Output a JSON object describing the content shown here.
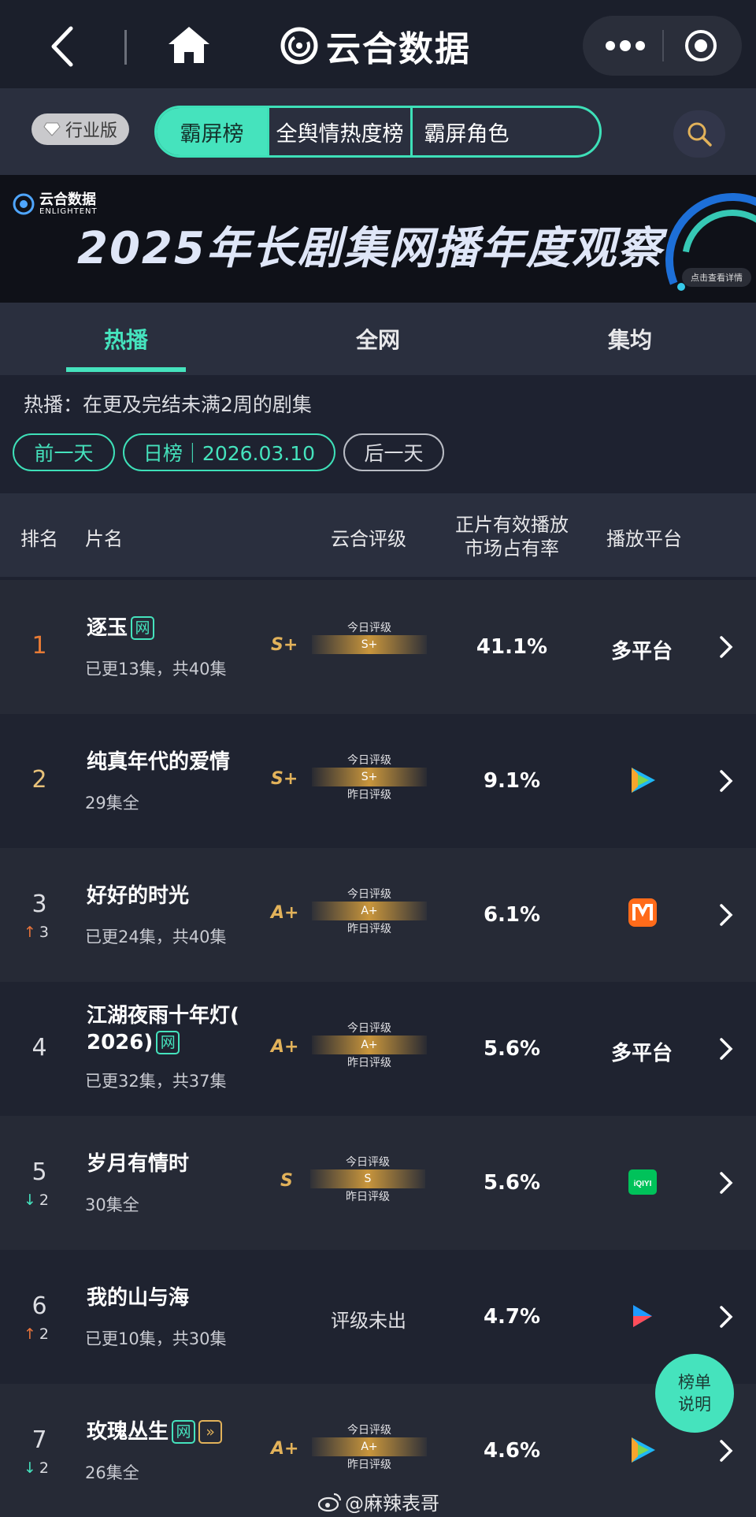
{
  "app": {
    "title": "云合数据"
  },
  "filter": {
    "edition": "行业版",
    "segments": [
      "霸屏榜",
      "全舆情热度榜",
      "霸屏角色"
    ]
  },
  "banner": {
    "brand": "云合数据",
    "brand_en": "ENLIGHTENT",
    "title": "2025年长剧集网播年度观察",
    "cta": "点击查看详情"
  },
  "tabs": [
    "热播",
    "全网",
    "集均"
  ],
  "description": "热播：在更及完结未满2周的剧集",
  "date_nav": {
    "prev": "前一天",
    "current": "日榜｜2026.03.10",
    "next": "后一天"
  },
  "table_head": {
    "rank": "排名",
    "name": "片名",
    "grade": "云合评级",
    "share_line1": "正片有效播放",
    "share_line2": "市场占有率",
    "platform": "播放平台"
  },
  "meter_labels": {
    "today": "今日评级",
    "yesterday": "昨日评级"
  },
  "rows": [
    {
      "rank": "1",
      "title": "逐玉",
      "tags": [
        "网"
      ],
      "sub": "已更13集，共40集",
      "grade": "S+",
      "meter_value": "S+",
      "share": "41.1%",
      "platform": "多平台",
      "platform_icon": ""
    },
    {
      "rank": "2",
      "title": "纯真年代的爱情",
      "tags": [],
      "sub": "29集全",
      "grade": "S+",
      "meter_value": "S+",
      "share": "9.1%",
      "platform": "",
      "platform_icon": "tencent-video-icon"
    },
    {
      "rank": "3",
      "trend": "up",
      "trend_value": "3",
      "title": "好好的时光",
      "tags": [],
      "sub": "已更24集，共40集",
      "grade": "A+",
      "meter_value": "A+",
      "share": "6.1%",
      "platform": "",
      "platform_icon": "mango-tv-icon"
    },
    {
      "rank": "4",
      "title_line1": "江湖夜雨十年灯(",
      "title_line2": "2026)",
      "tags": [
        "网"
      ],
      "sub": "已更32集，共37集",
      "grade": "A+",
      "meter_value": "A+",
      "share": "5.6%",
      "platform": "多平台",
      "platform_icon": ""
    },
    {
      "rank": "5",
      "trend": "down",
      "trend_value": "2",
      "title": "岁月有情时",
      "tags": [],
      "sub": "30集全",
      "grade": "S",
      "meter_value": "S",
      "share": "5.6%",
      "platform": "",
      "platform_icon": "iqiyi-icon"
    },
    {
      "rank": "6",
      "trend": "up",
      "trend_value": "2",
      "title": "我的山与海",
      "tags": [],
      "sub": "已更10集，共30集",
      "grade": "",
      "no_grade": "评级未出",
      "share": "4.7%",
      "platform": "",
      "platform_icon": "youku-icon"
    },
    {
      "rank": "7",
      "trend": "down",
      "trend_value": "2",
      "title": "玫瑰丛生",
      "tags": [
        "网"
      ],
      "sub": "26集全",
      "grade": "A+",
      "meter_value": "A+",
      "share": "4.6%",
      "platform": "",
      "platform_icon": "tencent-video-icon"
    }
  ],
  "fab": {
    "line1": "榜单",
    "line2": "说明"
  },
  "watermark_user": "@麻辣表哥",
  "colors": {
    "accent": "#45e3bd",
    "gold": "#e2b25a",
    "up": "#e8743b",
    "bg": "#1e2230"
  }
}
